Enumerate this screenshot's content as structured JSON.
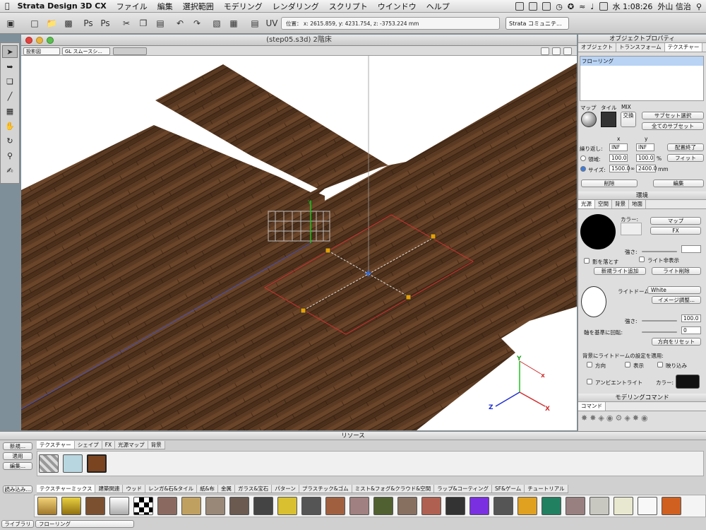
{
  "menubar": {
    "app": "Strata Design 3D CX",
    "items": [
      "ファイル",
      "編集",
      "選択範囲",
      "モデリング",
      "レンダリング",
      "スクリプト",
      "ウインドウ",
      "ヘルプ"
    ],
    "clock": "水 1:08:26",
    "user": "外山 信治"
  },
  "toolbar": {
    "coords": "位置： x: 2615.859, y: 4231.754, z: -3753.224 mm",
    "community": "Strata コミュニテ..."
  },
  "viewport": {
    "title": "(step05.s3d) 2階床",
    "projection": "投影図",
    "render_mode": "GL スムースシ..."
  },
  "object_props": {
    "title": "オブジェクトプロパティ",
    "tabs": [
      "オブジェクト",
      "トランスフォーム",
      "テクスチャー"
    ],
    "active_tab": "テクスチャー",
    "texture_list": [
      "フローリング"
    ],
    "map_label": "マップ",
    "tile_label": "タイル",
    "mix_label": "MIX",
    "swap_label": "交換",
    "subset_select": "サブセット選択",
    "all_subsets": "全てのサブセット",
    "x_label": "x",
    "y_label": "y",
    "repeat_label": "繰り返し:",
    "repeat_x": "INF",
    "repeat_y": "INF",
    "place_end": "配置終了",
    "area_label": "領域:",
    "area_x": "100.0",
    "area_y": "100.0",
    "pct": "%",
    "fit": "フィット",
    "size_label": "サイズ:",
    "size_x": "1500.0",
    "size_y": "2400.0",
    "mm": "mm",
    "delete": "削除",
    "edit": "編集"
  },
  "environment": {
    "title": "環境",
    "tabs": [
      "光源",
      "空間",
      "背景",
      "地面"
    ],
    "color_label": "カラー:",
    "map_select": "マップ",
    "fx_select": "FX",
    "strength_label": "強さ:",
    "cast_shadow": "影を落とす",
    "hide_light": "ライト非表示",
    "new_light": "新規ライト追加",
    "delete_light": "ライト削除",
    "lightdome_label": "ライトドーム:",
    "lightdome_value": "White",
    "image_adjust": "イメージ調整...",
    "strength_value": "100.0",
    "rotate_label": "軸を基準に回転:",
    "rotate_value": "0",
    "reset_dir": "方向をリセット",
    "bg_apply": "背景にライトドームの設定を適用:",
    "bg_dir": "方向",
    "bg_show": "表示",
    "bg_reflect": "映り込み",
    "ambient": "アンビエントライト",
    "ambient_color": "カラー:"
  },
  "modeling": {
    "title": "モデリングコマンド",
    "tab": "コマンド"
  },
  "resources": {
    "title": "リソース",
    "tabs": [
      "テクスチャー",
      "シェイプ",
      "FX",
      "光源マップ",
      "背景"
    ],
    "new": "新規...",
    "apply": "適用",
    "edit": "編集...",
    "load": "読み込み...",
    "lib_tabs": [
      "テクスチャーミックス",
      "建築関連",
      "ウッド",
      "レンガ&石&タイル",
      "紙&布",
      "金属",
      "ガラス&宝石",
      "パターン",
      "プラスチック&ゴム",
      "ミスト&フォグ&クラウド&空間",
      "ラップ&コーティング",
      "SF&ゲーム",
      "チュートリアル"
    ],
    "library_btn": "ライブラリ",
    "library_select": "フローリング"
  },
  "colors": {
    "wood": "#5a3a22",
    "selection": "#d03030"
  }
}
